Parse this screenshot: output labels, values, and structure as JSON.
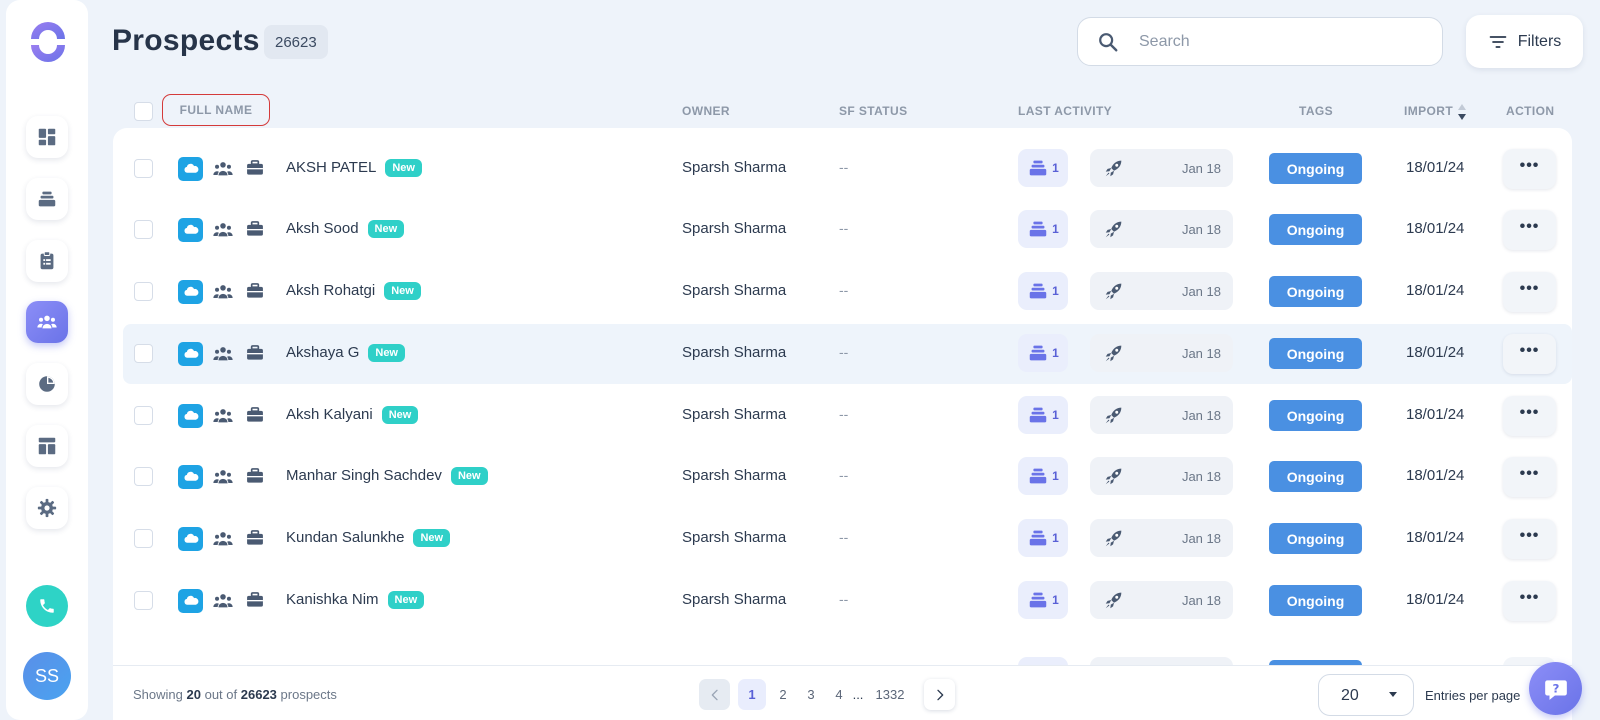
{
  "header": {
    "title": "Prospects",
    "count": "26623",
    "search_placeholder": "Search",
    "filters_label": "Filters"
  },
  "sidebar": {
    "items": [
      "dashboard-icon",
      "layers-icon",
      "clipboard-icon",
      "users-icon",
      "pie-chart-icon",
      "layout-icon",
      "gear-icon"
    ],
    "active": "users-icon",
    "avatar_initials": "SS"
  },
  "table": {
    "columns": {
      "full_name": "FULL NAME",
      "owner": "OWNER",
      "sf_status": "SF STATUS",
      "last_activity": "LAST ACTIVITY",
      "tags": "TAGS",
      "import": "IMPORT",
      "action": "ACTION"
    },
    "rows": [
      {
        "name": "AKSH PATEL",
        "badge": "New",
        "owner": "Sparsh Sharma",
        "sf_status": "--",
        "activity_count": "1",
        "activity_date": "Jan 18",
        "tag": "Ongoing",
        "import": "18/01/24",
        "action": "•••"
      },
      {
        "name": "Aksh Sood",
        "badge": "New",
        "owner": "Sparsh Sharma",
        "sf_status": "--",
        "activity_count": "1",
        "activity_date": "Jan 18",
        "tag": "Ongoing",
        "import": "18/01/24",
        "action": "•••"
      },
      {
        "name": "Aksh Rohatgi",
        "badge": "New",
        "owner": "Sparsh Sharma",
        "sf_status": "--",
        "activity_count": "1",
        "activity_date": "Jan 18",
        "tag": "Ongoing",
        "import": "18/01/24",
        "action": "•••"
      },
      {
        "name": "Akshaya G",
        "badge": "New",
        "owner": "Sparsh Sharma",
        "sf_status": "--",
        "activity_count": "1",
        "activity_date": "Jan 18",
        "tag": "Ongoing",
        "import": "18/01/24",
        "action": "•••"
      },
      {
        "name": "Aksh Kalyani",
        "badge": "New",
        "owner": "Sparsh Sharma",
        "sf_status": "--",
        "activity_count": "1",
        "activity_date": "Jan 18",
        "tag": "Ongoing",
        "import": "18/01/24",
        "action": "•••"
      },
      {
        "name": "Manhar Singh Sachdev",
        "badge": "New",
        "owner": "Sparsh Sharma",
        "sf_status": "--",
        "activity_count": "1",
        "activity_date": "Jan 18",
        "tag": "Ongoing",
        "import": "18/01/24",
        "action": "•••"
      },
      {
        "name": "Kundan Salunkhe",
        "badge": "New",
        "owner": "Sparsh Sharma",
        "sf_status": "--",
        "activity_count": "1",
        "activity_date": "Jan 18",
        "tag": "Ongoing",
        "import": "18/01/24",
        "action": "•••"
      },
      {
        "name": "Kanishka Nim",
        "badge": "New",
        "owner": "Sparsh Sharma",
        "sf_status": "--",
        "activity_count": "1",
        "activity_date": "Jan 18",
        "tag": "Ongoing",
        "import": "18/01/24",
        "action": "•••"
      }
    ]
  },
  "footer": {
    "showing_prefix": "Showing",
    "showing_count": "20",
    "showing_mid": "out of",
    "showing_total": "26623",
    "showing_suffix": "prospects",
    "pages": [
      "1",
      "2",
      "3",
      "4"
    ],
    "ellipsis": "...",
    "last_page": "1332",
    "entries_value": "20",
    "entries_label": "Entries per page"
  },
  "colors": {
    "accent": "#6a73e8",
    "tag": "#4a90e2",
    "new_badge": "#2fd0c8",
    "salesforce": "#1ea3e4"
  }
}
